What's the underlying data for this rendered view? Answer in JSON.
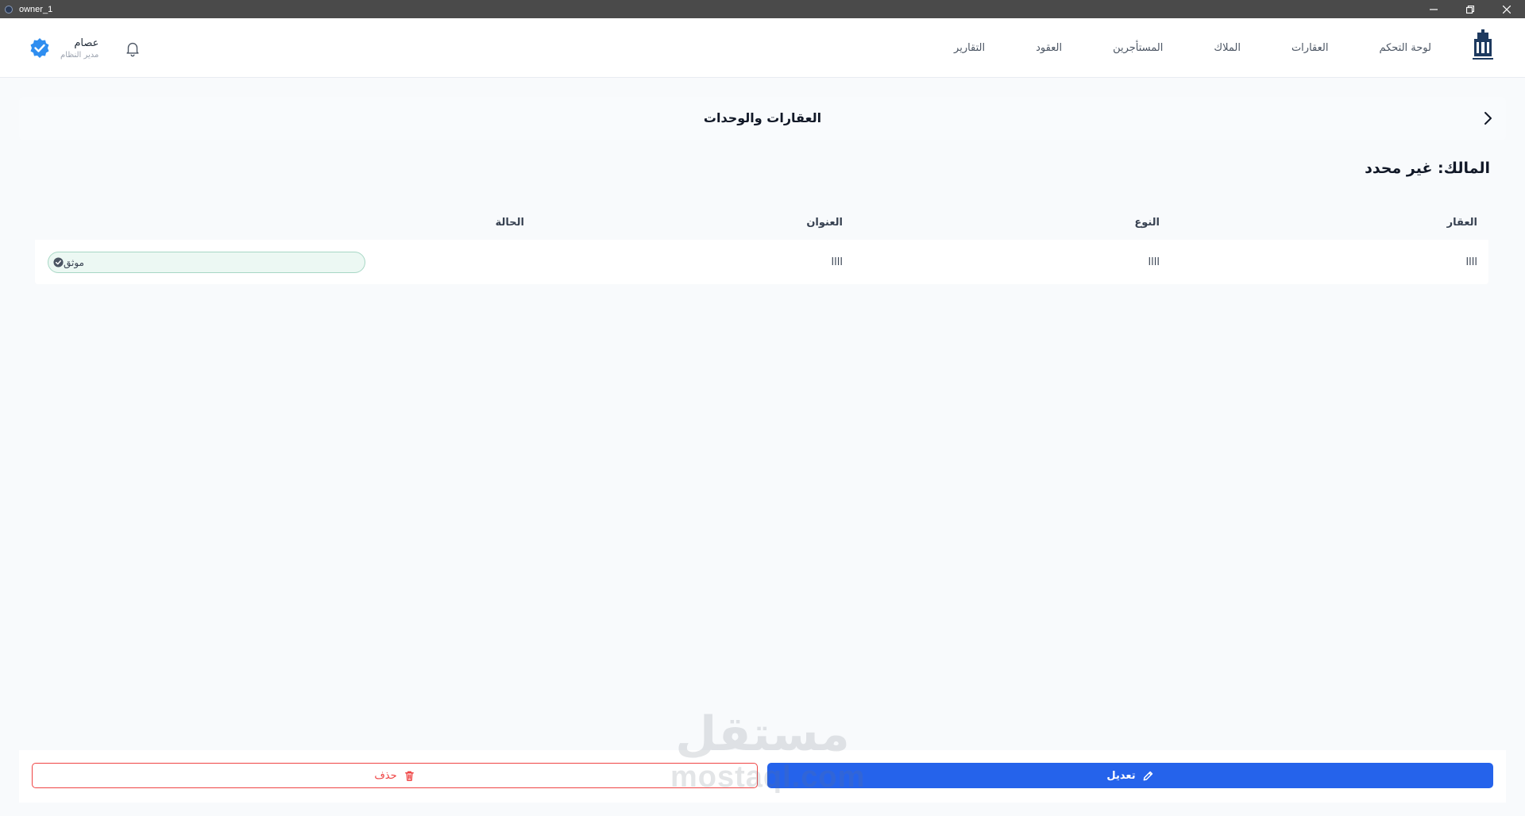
{
  "window": {
    "title": "owner_1"
  },
  "nav": {
    "items": [
      {
        "label": "لوحة التحكم"
      },
      {
        "label": "العقارات"
      },
      {
        "label": "الملاك"
      },
      {
        "label": "المستأجرين"
      },
      {
        "label": "العقود"
      },
      {
        "label": "التقارير"
      }
    ]
  },
  "user": {
    "name": "عصام",
    "role": "مدير النظام"
  },
  "page": {
    "title": "العقارات والوحدات",
    "owner_label": "المالك: غير محدد"
  },
  "table": {
    "headers": [
      "العقار",
      "النوع",
      "العنوان",
      "الحالة"
    ],
    "rows": [
      {
        "property": "llll",
        "type": "llll",
        "address": "llll",
        "status": "موثق"
      }
    ]
  },
  "actions": {
    "edit_label": "تعديل",
    "delete_label": "حذف"
  },
  "watermark": {
    "arabic": "مستقل",
    "latin": "mostaql.com"
  },
  "colors": {
    "primary": "#2563eb",
    "danger": "#ef4444",
    "verified": "#2f8ef0",
    "status_bg": "#ecf8f3",
    "status_border": "#a7d7c5"
  }
}
